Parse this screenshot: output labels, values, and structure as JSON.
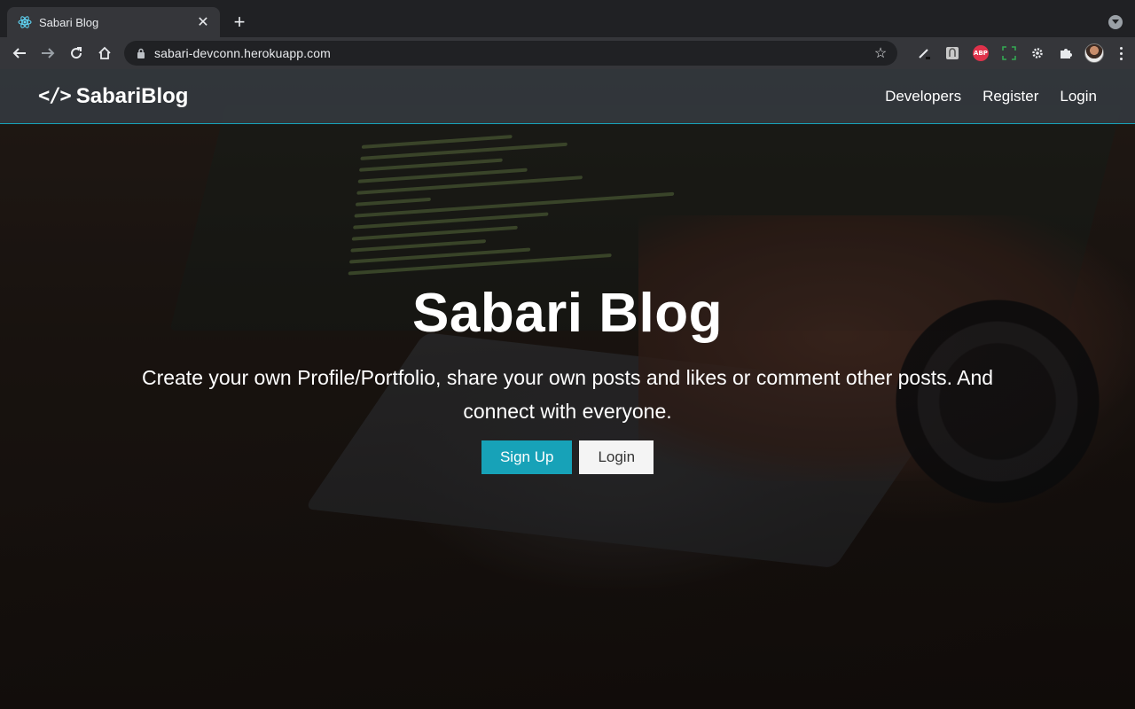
{
  "browser": {
    "tab_title": "Sabari Blog",
    "url": "sabari-devconn.herokuapp.com",
    "extensions": [
      "pen-icon",
      "dark-mode-icon",
      "adblock-plus-icon",
      "screenshot-icon",
      "settings-gear-icon",
      "puzzle-icon",
      "profile-avatar"
    ],
    "abp_label": "ABP"
  },
  "navbar": {
    "brand_icon": "</>",
    "brand": "SabariBlog",
    "links": [
      "Developers",
      "Register",
      "Login"
    ]
  },
  "hero": {
    "title": "Sabari Blog",
    "lead": "Create your own Profile/Portfolio, share your own posts and likes or comment other posts. And connect with everyone.",
    "buttons": {
      "signup": "Sign Up",
      "login": "Login"
    }
  },
  "colors": {
    "accent": "#17a2b8",
    "navbar_bg": "#343a40",
    "light_button": "#f4f4f4"
  }
}
